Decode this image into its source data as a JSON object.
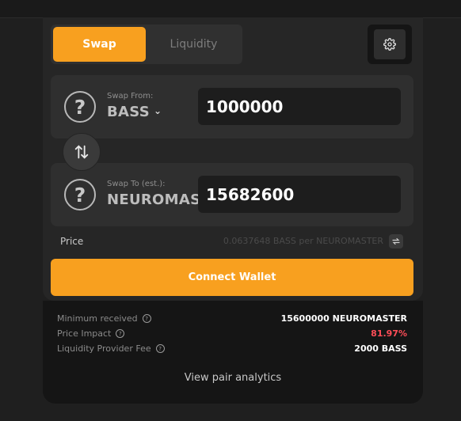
{
  "tabs": {
    "swap": "Swap",
    "liquidity": "Liquidity"
  },
  "icons": {
    "settings": "gear-icon",
    "token_placeholder": "question-circle-icon",
    "switch": "swap-arrows-icon"
  },
  "from": {
    "label": "Swap From:",
    "token": "BASS",
    "amount": "1000000"
  },
  "to": {
    "label": "Swap To (est.):",
    "token": "NEUROMASTER",
    "amount": "15682600"
  },
  "price": {
    "label": "Price",
    "value": "0.0637648 BASS per NEUROMASTER"
  },
  "connect_label": "Connect Wallet",
  "details": {
    "min_received_label": "Minimum received",
    "min_received_value": "15600000 NEUROMASTER",
    "price_impact_label": "Price Impact",
    "price_impact_value": "81.97%",
    "lp_fee_label": "Liquidity Provider Fee",
    "lp_fee_value": "2000 BASS"
  },
  "analytics_label": "View pair analytics",
  "colors": {
    "accent": "#f8a01f",
    "danger": "#ff4d57"
  }
}
